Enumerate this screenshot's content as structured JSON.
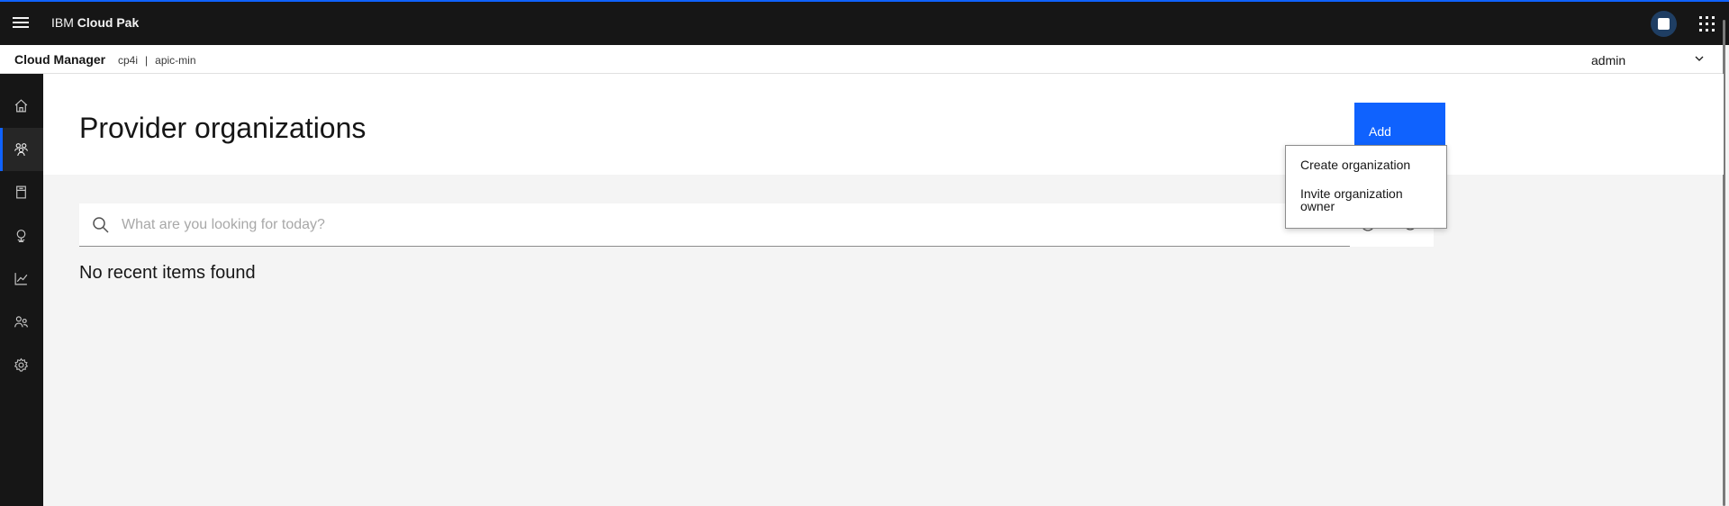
{
  "topbar": {
    "brand_prefix": "IBM",
    "brand_name": "Cloud Pak"
  },
  "subheader": {
    "title": "Cloud Manager",
    "crumb_1": "cp4i",
    "crumb_sep": "|",
    "crumb_2": "apic-min",
    "user": "admin"
  },
  "sidebar": {
    "items": [
      {
        "icon": "home-icon",
        "active": false
      },
      {
        "icon": "organizations-icon",
        "active": true
      },
      {
        "icon": "resources-icon",
        "active": false
      },
      {
        "icon": "topology-icon",
        "active": false
      },
      {
        "icon": "analytics-icon",
        "active": false
      },
      {
        "icon": "members-icon",
        "active": false
      },
      {
        "icon": "settings-icon",
        "active": false
      }
    ]
  },
  "page": {
    "title": "Provider organizations",
    "add_label": "Add"
  },
  "search": {
    "placeholder": "What are you looking for today?",
    "value": ""
  },
  "empty_message": "No recent items found",
  "add_menu": {
    "items": [
      "Create organization",
      "Invite organization owner"
    ]
  },
  "colors": {
    "accent": "#0f62fe",
    "shell": "#161616",
    "background": "#f4f4f4"
  }
}
